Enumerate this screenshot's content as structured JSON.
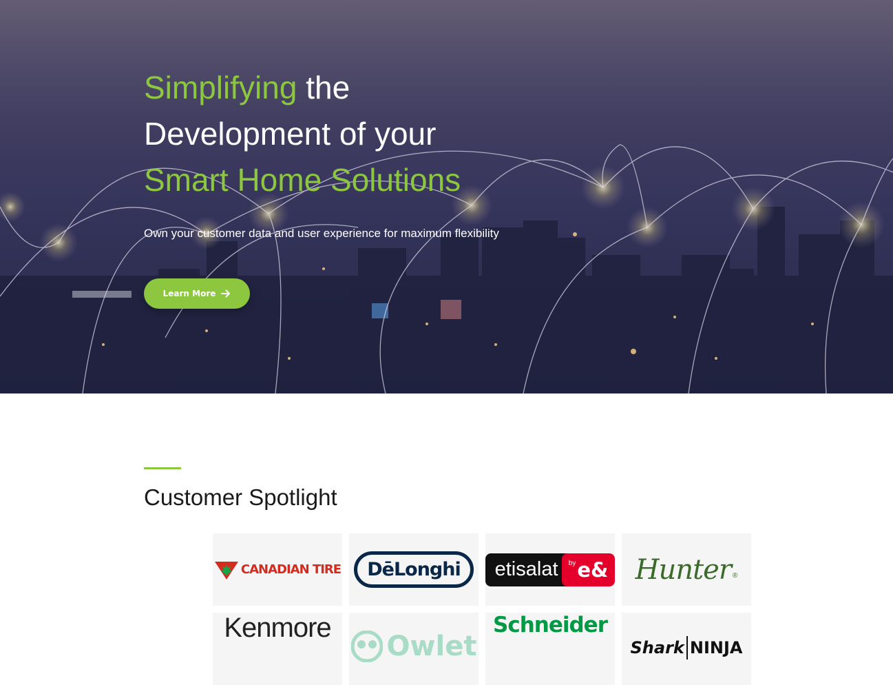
{
  "hero": {
    "headline": {
      "line1_highlight": "Simplifying",
      "line1_rest": " the",
      "line2": "Development of your",
      "line3_highlight": "Smart Home Solutions"
    },
    "subtitle": "Own your customer data and user experience for maximum flexibility",
    "cta_label": "Learn More",
    "cta_icon": "arrow-right-icon",
    "background": "night-city-network-image"
  },
  "colors": {
    "accent": "#8dc63f",
    "hero_overlay": "#34335a",
    "heading_text": "#1a1a1a",
    "tile_background": "#f5f5f5"
  },
  "spotlight": {
    "title": "Customer Spotlight",
    "logos": [
      {
        "brand": "Canadian Tire",
        "text": "CANADIAN TIRE"
      },
      {
        "brand": "DeLonghi",
        "text": "DēLonghi"
      },
      {
        "brand": "etisalat by e&",
        "text": "etisalat",
        "badge_by": "by",
        "badge_mark": "e&"
      },
      {
        "brand": "Hunter",
        "text": "Hunter",
        "mark": "®"
      },
      {
        "brand": "Kenmore",
        "text": "Kenmore"
      },
      {
        "brand": "Owlet",
        "text": "Owlet"
      },
      {
        "brand": "Schneider Electric",
        "text": "Schneider"
      },
      {
        "brand": "SharkNinja",
        "text_shark": "Shark",
        "text_ninja": "NINJA"
      }
    ]
  }
}
